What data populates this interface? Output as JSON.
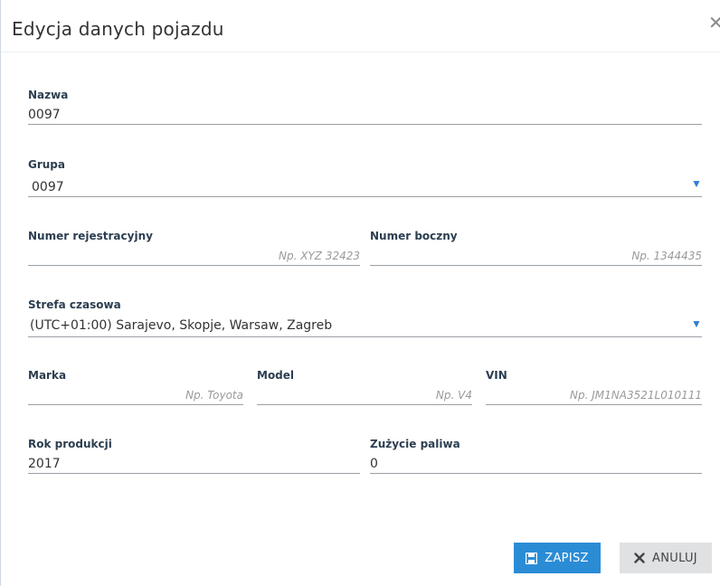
{
  "dialog": {
    "title": "Edycja danych pojazdu",
    "close_label": "✕"
  },
  "fields": {
    "name": {
      "label": "Nazwa",
      "value": "0097"
    },
    "group": {
      "label": "Grupa",
      "value": "0097"
    },
    "registration": {
      "label": "Numer rejestracyjny",
      "value": "",
      "placeholder": "Np. XYZ 32423"
    },
    "side_number": {
      "label": "Numer boczny",
      "value": "",
      "placeholder": "Np. 1344435"
    },
    "timezone": {
      "label": "Strefa czasowa",
      "value": "(UTC+01:00) Sarajevo, Skopje, Warsaw, Zagreb"
    },
    "make": {
      "label": "Marka",
      "value": "",
      "placeholder": "Np. Toyota"
    },
    "model": {
      "label": "Model",
      "value": "",
      "placeholder": "Np. V4"
    },
    "vin": {
      "label": "VIN",
      "value": "",
      "placeholder": "Np. JM1NA3521L010111"
    },
    "production_year": {
      "label": "Rok produkcji",
      "value": "2017"
    },
    "fuel_consumption": {
      "label": "Zużycie paliwa",
      "value": "0"
    }
  },
  "buttons": {
    "save": "ZAPISZ",
    "cancel": "ANULUJ"
  },
  "colors": {
    "accent": "#2b8cd6",
    "arrow": "#2b7fd4",
    "cancel_bg": "#dfe1e3"
  }
}
